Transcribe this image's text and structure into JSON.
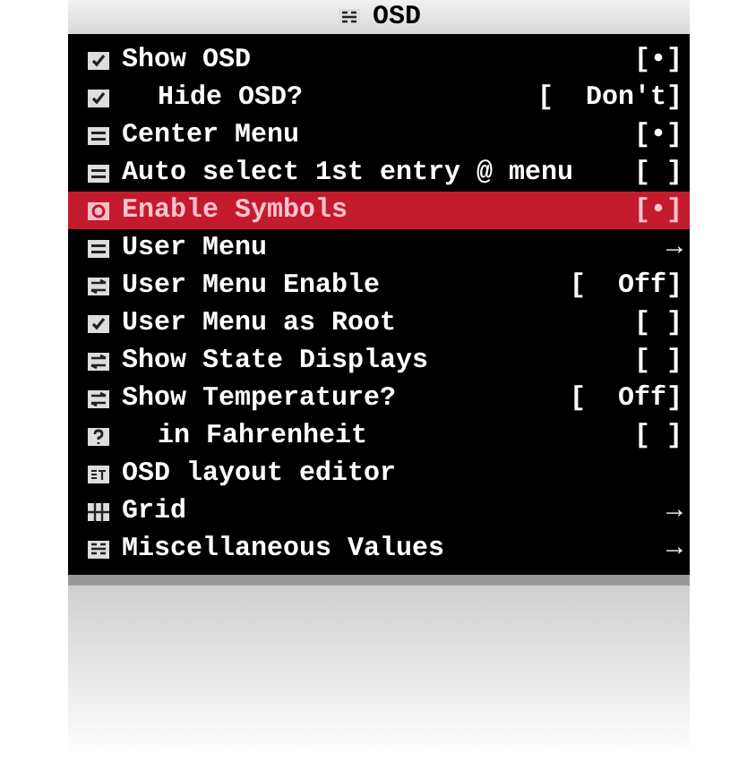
{
  "title": "OSD",
  "items": [
    {
      "kind": "checkbox",
      "label": "Show OSD",
      "value": "[•]",
      "selected": false,
      "children": [
        {
          "kind": "checkbox",
          "label": "Hide OSD?",
          "bracket": "[",
          "value": "Don't]",
          "selected": false
        }
      ]
    },
    {
      "kind": "menu",
      "label": "Center Menu",
      "value": "[•]",
      "selected": false
    },
    {
      "kind": "menu",
      "label": "Auto select 1st entry @ menu",
      "value": "[ ]",
      "selected": false
    },
    {
      "kind": "symbols",
      "label": "Enable Symbols",
      "value": "[•]",
      "selected": true
    },
    {
      "kind": "menu",
      "label": "User Menu",
      "value": "→",
      "selected": false
    },
    {
      "kind": "toggle",
      "label": "User Menu Enable",
      "bracket": "[",
      "value": "Off]",
      "selected": false
    },
    {
      "kind": "checkbox",
      "label": "User Menu as Root",
      "value": "[ ]",
      "selected": false
    },
    {
      "kind": "toggle",
      "label": "Show State Displays",
      "value": "[ ]",
      "selected": false
    },
    {
      "kind": "toggle",
      "label": "Show Temperature?",
      "bracket": "[",
      "value": "Off]",
      "selected": false,
      "children": [
        {
          "kind": "help",
          "label": "in Fahrenheit",
          "value": "[ ]",
          "selected": false
        }
      ]
    },
    {
      "kind": "set",
      "label": "OSD layout editor",
      "selected": false
    },
    {
      "kind": "grid",
      "label": "Grid",
      "value": "→",
      "selected": false
    },
    {
      "kind": "osd",
      "label": "Miscellaneous Values",
      "value": "→",
      "selected": false
    }
  ]
}
